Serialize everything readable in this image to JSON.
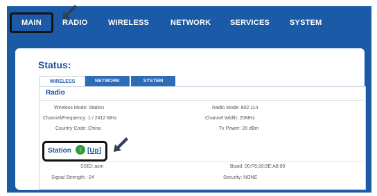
{
  "nav": {
    "items": [
      {
        "label": "MAIN"
      },
      {
        "label": "RADIO"
      },
      {
        "label": "WIRELESS"
      },
      {
        "label": "NETWORK"
      },
      {
        "label": "SERVICES"
      },
      {
        "label": "SYSTEM"
      }
    ]
  },
  "status": {
    "title": "Status:",
    "tabs": [
      {
        "label": "WIRELESS"
      },
      {
        "label": "NETWORK"
      },
      {
        "label": "SYSTEM"
      }
    ],
    "radio": {
      "title": "Radio",
      "fields": {
        "wireless_mode": "Wireless Mode: Station",
        "channel_frequency": "Channel/Frequency: 1 / 2412 MHz",
        "country_code": "Country Code: China",
        "radio_mode": "Radio Mode: 802.11n",
        "channel_width": "Channel Width: 20MHz",
        "tx_power": "Tx Power: 20 dBm"
      }
    },
    "station": {
      "title": "Station",
      "up_label": "[Up]",
      "fields": {
        "ssid": "SSID: asm",
        "signal_strength": "Signal Strength: -24",
        "bssid": "Bssid: 00:F6:20:9E:A8:00",
        "security": "Security: NONE"
      }
    }
  },
  "colors": {
    "nav_bg": "#1a5aa6",
    "accent": "#1c4f9c",
    "up_icon": "#2f9b3a"
  }
}
